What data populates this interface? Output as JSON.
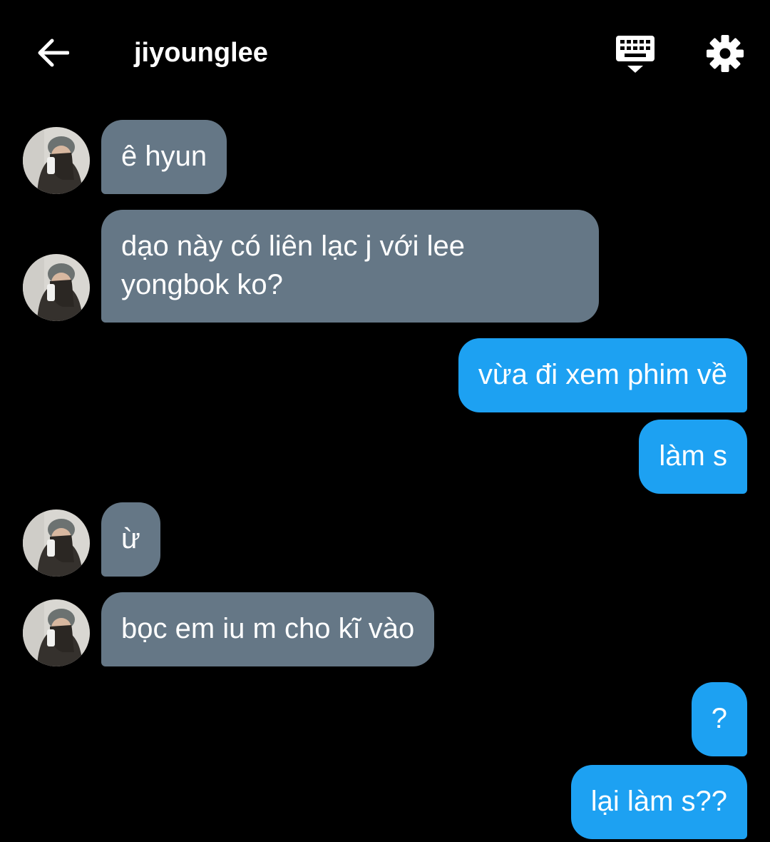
{
  "header": {
    "title": "jiyounglee",
    "back_icon": "arrow-left-icon",
    "keyboard_icon": "keyboard-icon",
    "settings_icon": "gear-icon"
  },
  "colors": {
    "background": "#000000",
    "incoming_bubble": "#657786",
    "outgoing_bubble": "#1da1f2",
    "text": "#ffffff"
  },
  "messages": [
    {
      "direction": "incoming",
      "text": "ê hyun"
    },
    {
      "direction": "incoming",
      "text": "dạo này có liên lạc j với lee\nyongbok ko?"
    },
    {
      "direction": "outgoing",
      "text": "vừa đi xem phim về"
    },
    {
      "direction": "outgoing",
      "text": "làm s"
    },
    {
      "direction": "incoming",
      "text": "ừ"
    },
    {
      "direction": "incoming",
      "text": "bọc em iu m cho kĩ vào"
    },
    {
      "direction": "outgoing",
      "text": "?"
    },
    {
      "direction": "outgoing",
      "text": "lại làm s??"
    }
  ]
}
